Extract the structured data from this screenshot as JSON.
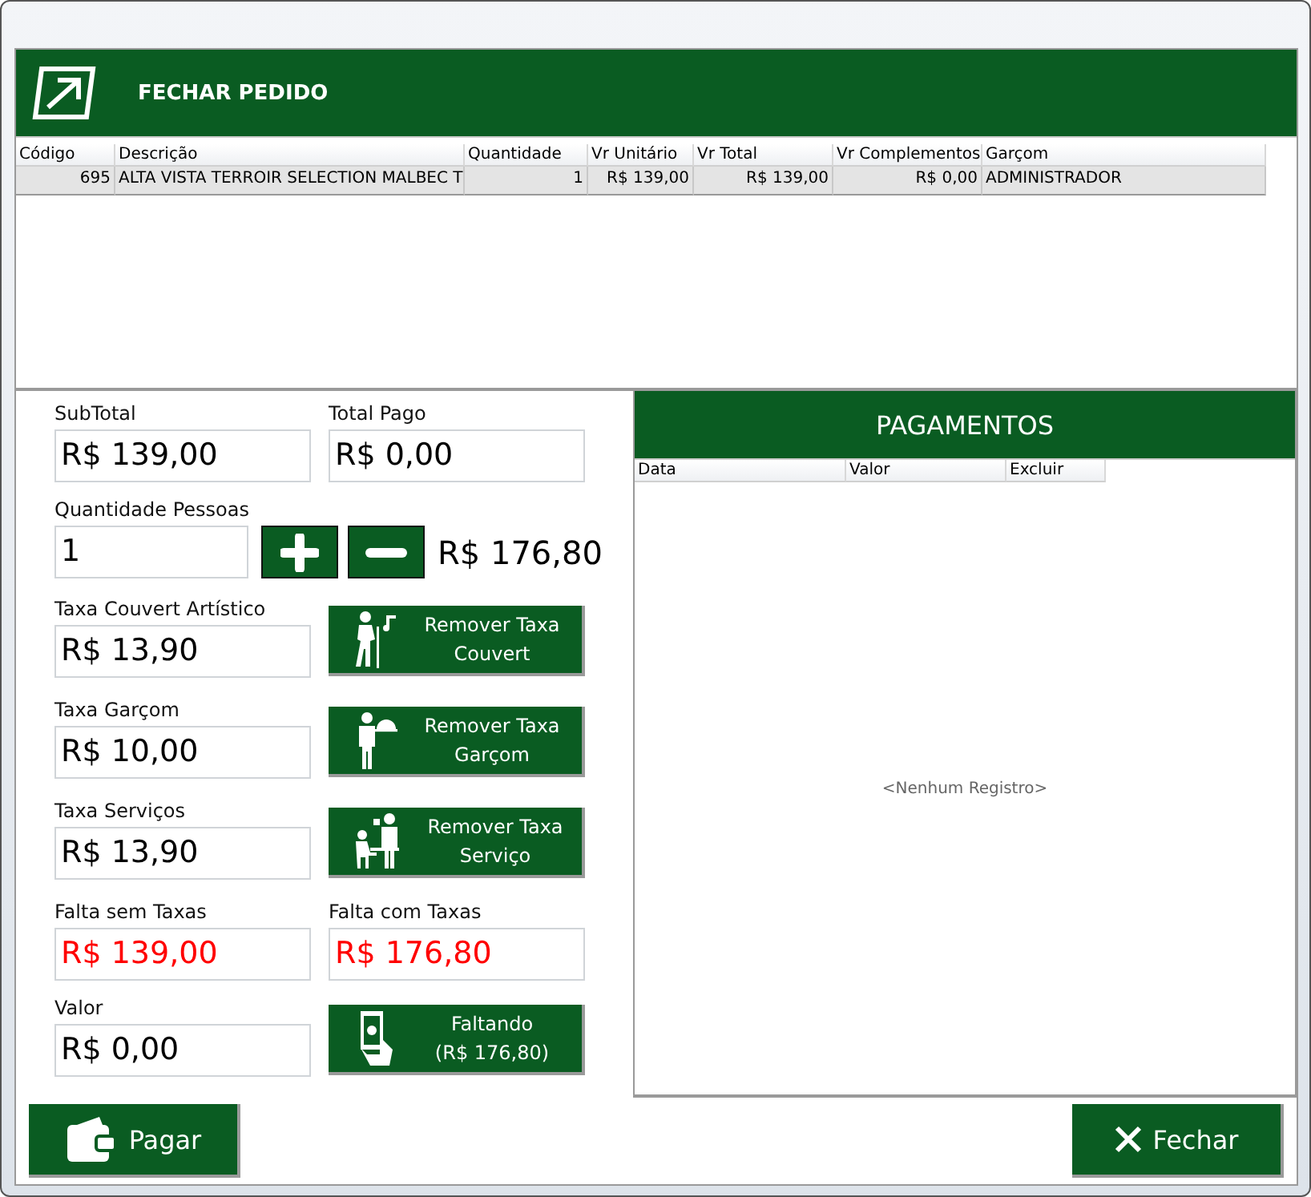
{
  "header": {
    "title": "FECHAR PEDIDO"
  },
  "table": {
    "columns": [
      "Código",
      "Descrição",
      "Quantidade",
      "Vr Unitário",
      "Vr Total",
      "Vr Complementos",
      "Garçom"
    ],
    "rows": [
      {
        "selected": true,
        "cells": [
          "695",
          "ALTA VISTA TERROIR SELECTION MALBEC T",
          "1",
          "R$ 139,00",
          "R$ 139,00",
          "R$ 0,00",
          "ADMINISTRADOR"
        ]
      }
    ]
  },
  "summary": [
    {
      "label": "SubTotal",
      "value": "R$ 139,00"
    },
    {
      "label": "Total Pago",
      "value": "R$ 0,00"
    }
  ],
  "people": {
    "label": "Quantidade Pessoas",
    "value": "1",
    "total": "R$ 176,80"
  },
  "taxes": [
    {
      "label": "Taxa Couvert Artístico",
      "value": "R$ 13,90",
      "button": [
        "Remover Taxa",
        "Couvert"
      ]
    },
    {
      "label": "Taxa Garçom",
      "value": "R$ 10,00",
      "button": [
        "Remover Taxa",
        "Garçom"
      ]
    },
    {
      "label": "Taxa Serviços",
      "value": "R$ 13,90",
      "button": [
        "Remover Taxa",
        "Serviço"
      ]
    }
  ],
  "remaining": [
    {
      "label": "Falta sem Taxas",
      "value": "R$ 139,00",
      "alert": true
    },
    {
      "label": "Falta com Taxas",
      "value": "R$ 176,80",
      "alert": true
    }
  ],
  "amount": {
    "label": "Valor",
    "value": "R$ 0,00",
    "button": [
      "Faltando",
      "(R$ 176,80)"
    ]
  },
  "payments": {
    "title": "PAGAMENTOS",
    "columns": [
      "Data",
      "Valor",
      "Excluir"
    ],
    "empty": "<Nenhum Registro>"
  },
  "footer": {
    "pay": "Pagar",
    "close": "Fechar"
  }
}
